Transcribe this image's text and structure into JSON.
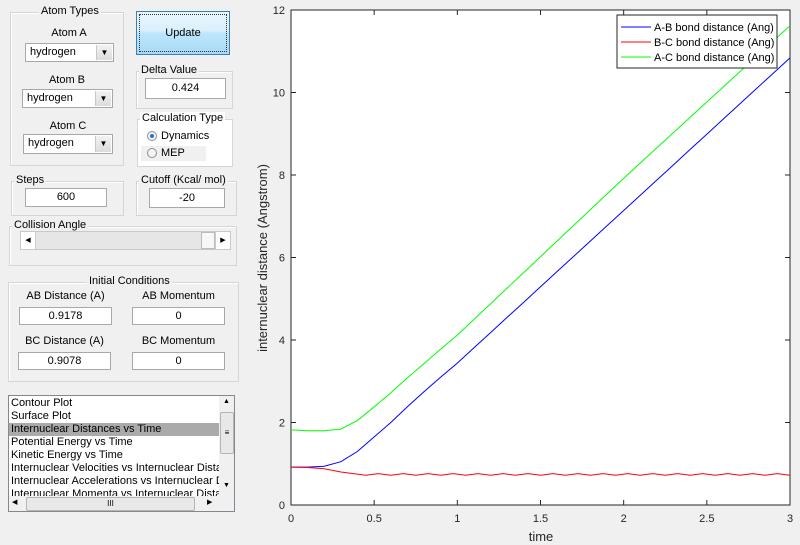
{
  "atom_types": {
    "title": "Atom Types",
    "atom_a_label": "Atom A",
    "atom_a": "hydrogen",
    "atom_b_label": "Atom B",
    "atom_b": "hydrogen",
    "atom_c_label": "Atom C",
    "atom_c": "hydrogen"
  },
  "update_label": "Update",
  "delta": {
    "title": "Delta Value",
    "value": "0.424"
  },
  "calc_type": {
    "title": "Calculation Type",
    "options": [
      "Dynamics",
      "MEP"
    ],
    "selected": "Dynamics"
  },
  "steps": {
    "title": "Steps",
    "value": "600"
  },
  "cutoff": {
    "title": "Cutoff (Kcal/ mol)",
    "value": "-20"
  },
  "collision": {
    "title": "Collision Angle",
    "slider_fraction": 1.0
  },
  "initial": {
    "title": "Initial Conditions",
    "ab_dist_label": "AB Distance (A)",
    "ab_dist": "0.9178",
    "ab_mom_label": "AB Momentum",
    "ab_mom": "0",
    "bc_dist_label": "BC Distance (A)",
    "bc_dist": "0.9078",
    "bc_mom_label": "BC Momentum",
    "bc_mom": "0"
  },
  "plot_list": {
    "items": [
      "Contour Plot",
      "Surface Plot",
      "Internuclear Distances vs Time",
      "Potential Energy vs Time",
      "Kinetic Energy vs Time",
      "Internuclear Velocities vs Internuclear Distance",
      "Internuclear Accelerations vs Internuclear Distance",
      "Internuclear Momenta vs Internuclear Distance"
    ],
    "selected_index": 2,
    "hscroll_glyph": "III"
  },
  "chart_data": {
    "type": "line",
    "xlabel": "time",
    "ylabel": "internuclear distance (Angstrom)",
    "xlim": [
      0,
      3
    ],
    "ylim": [
      0,
      12
    ],
    "xticks": [
      "0",
      "0.5",
      "1",
      "1.5",
      "2",
      "2.5",
      "3"
    ],
    "yticks": [
      "0",
      "2",
      "4",
      "6",
      "8",
      "10",
      "12"
    ],
    "grid": false,
    "legend_position": "top-right",
    "series": [
      {
        "name": "A-B bond distance (Ang)",
        "color": "#0000ff",
        "x": [
          0,
          0.1,
          0.2,
          0.3,
          0.4,
          0.5,
          0.6,
          0.7,
          0.8,
          0.9,
          1.0,
          1.1,
          1.2,
          1.3,
          1.4,
          1.5,
          1.6,
          1.7,
          1.8,
          1.9,
          2.0,
          2.1,
          2.2,
          2.3,
          2.4,
          2.5,
          2.6,
          2.7,
          2.8,
          2.9,
          3.0
        ],
        "y": [
          0.92,
          0.92,
          0.94,
          1.05,
          1.3,
          1.65,
          2.0,
          2.38,
          2.75,
          3.1,
          3.44,
          3.81,
          4.18,
          4.55,
          4.92,
          5.29,
          5.66,
          6.03,
          6.4,
          6.77,
          7.14,
          7.51,
          7.88,
          8.25,
          8.62,
          8.99,
          9.36,
          9.73,
          10.1,
          10.47,
          10.84
        ]
      },
      {
        "name": "B-C bond distance (Ang)",
        "color": "#ff0000",
        "x": [
          0,
          0.1,
          0.2,
          0.3,
          0.375,
          0.45,
          0.525,
          0.6,
          0.675,
          0.75,
          0.825,
          0.9,
          0.975,
          1.05,
          1.125,
          1.2,
          1.275,
          1.35,
          1.425,
          1.5,
          1.575,
          1.65,
          1.725,
          1.8,
          1.875,
          1.95,
          2.025,
          2.1,
          2.175,
          2.25,
          2.325,
          2.4,
          2.475,
          2.55,
          2.625,
          2.7,
          2.775,
          2.85,
          2.925,
          3.0
        ],
        "y": [
          0.92,
          0.91,
          0.88,
          0.8,
          0.76,
          0.72,
          0.76,
          0.72,
          0.76,
          0.72,
          0.76,
          0.72,
          0.76,
          0.72,
          0.76,
          0.72,
          0.76,
          0.72,
          0.76,
          0.72,
          0.76,
          0.72,
          0.76,
          0.72,
          0.76,
          0.72,
          0.76,
          0.72,
          0.76,
          0.72,
          0.76,
          0.72,
          0.76,
          0.72,
          0.76,
          0.72,
          0.76,
          0.72,
          0.76,
          0.72
        ]
      },
      {
        "name": "A-C bond distance (Ang)",
        "color": "#00ff00",
        "x": [
          0,
          0.1,
          0.2,
          0.3,
          0.4,
          0.5,
          0.6,
          0.7,
          0.8,
          0.9,
          1.0,
          1.1,
          1.2,
          1.3,
          1.4,
          1.5,
          1.6,
          1.7,
          1.8,
          1.9,
          2.0,
          2.1,
          2.2,
          2.3,
          2.4,
          2.5,
          2.6,
          2.7,
          2.8,
          2.9,
          3.0
        ],
        "y": [
          1.82,
          1.8,
          1.8,
          1.84,
          2.05,
          2.38,
          2.72,
          3.08,
          3.43,
          3.78,
          4.12,
          4.5,
          4.88,
          5.26,
          5.64,
          6.02,
          6.4,
          6.78,
          7.16,
          7.54,
          7.92,
          8.29,
          8.66,
          9.03,
          9.4,
          9.77,
          10.14,
          10.51,
          10.88,
          11.25,
          11.62
        ]
      }
    ]
  }
}
